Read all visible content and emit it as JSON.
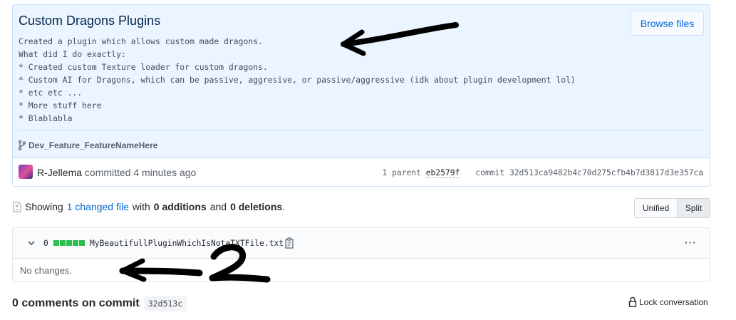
{
  "commit": {
    "title": "Custom Dragons Plugins",
    "browse_label": "Browse files",
    "description_lines": [
      "Created a plugin which allows custom made dragons.",
      "What did I do exactly:",
      "* Created custom Texture loader for custom dragons.",
      "* Custom AI for Dragons, which can be passive, aggresive, or passive/aggressive (idk about plugin development lol)",
      "* etc etc ...",
      "* More stuff here",
      "* Blablabla"
    ],
    "branch": "Dev_Feature_FeatureNameHere",
    "author": "R-Jellema",
    "committed_text": "committed 4 minutes ago",
    "parent_count_label": "1 parent",
    "parent_sha": "eb2579f",
    "commit_label": "commit",
    "commit_sha": "32d513ca9482b4c70d275cfb4b7d3817d3e357ca",
    "icons": {
      "branch": "git-branch-icon",
      "avatar": "user-avatar"
    }
  },
  "summary": {
    "showing": "Showing",
    "changed_files": "1 changed file",
    "with": "with",
    "additions": "0 additions",
    "and": "and",
    "deletions": "0 deletions",
    "period": "."
  },
  "view_toggle": {
    "unified": "Unified",
    "split": "Split",
    "active": "Split"
  },
  "file": {
    "count": "0",
    "name": "MyBeautifullPluginWhichIsNotaTXTFile.txt",
    "body_text": "No changes.",
    "diffstat_color": "#2cbe4e"
  },
  "comments": {
    "title": "0 comments on commit",
    "short_sha": "32d513c",
    "lock_label": "Lock conversation"
  },
  "annotations": {
    "number_label": "2"
  }
}
